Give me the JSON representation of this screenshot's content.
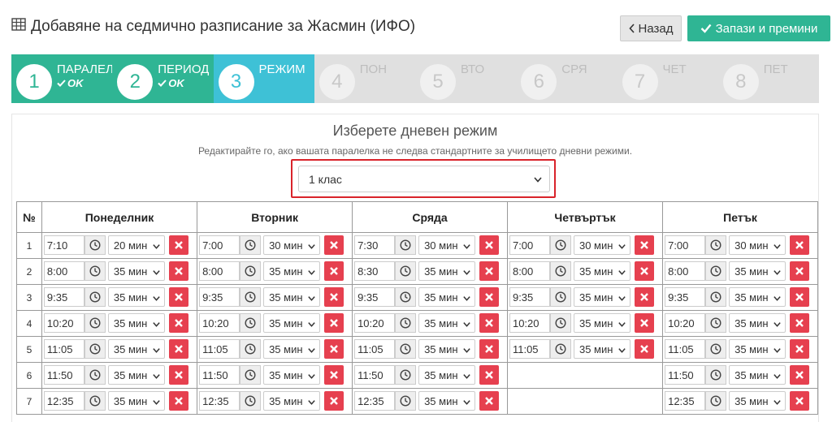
{
  "header": {
    "title": "Добавяне на седмично разписание за Жасмин (ИФО)",
    "back_label": "Назад",
    "save_label": "Запази и премини"
  },
  "steps": [
    {
      "num": "1",
      "label": "ПАРАЛЕЛ",
      "status": "OK",
      "state": "done"
    },
    {
      "num": "2",
      "label": "ПЕРИОД",
      "status": "OK",
      "state": "done"
    },
    {
      "num": "3",
      "label": "РЕЖИМ",
      "status": "",
      "state": "active"
    },
    {
      "num": "4",
      "label": "ПОН",
      "status": "",
      "state": "todo"
    },
    {
      "num": "5",
      "label": "ВТО",
      "status": "",
      "state": "todo"
    },
    {
      "num": "6",
      "label": "СРЯ",
      "status": "",
      "state": "todo"
    },
    {
      "num": "7",
      "label": "ЧЕТ",
      "status": "",
      "state": "todo"
    },
    {
      "num": "8",
      "label": "ПЕТ",
      "status": "",
      "state": "todo"
    }
  ],
  "regime": {
    "title": "Изберете дневен режим",
    "description": "Редактирайте го, ако вашата паралелка не следва стандартните за училището дневни режими.",
    "selected": "1 клас"
  },
  "table": {
    "num_header": "№",
    "days": [
      "Понеделник",
      "Вторник",
      "Сряда",
      "Четвъртък",
      "Петък"
    ],
    "rows": [
      {
        "num": "1",
        "cells": [
          {
            "time": "7:10",
            "duration": "20 мин"
          },
          {
            "time": "7:00",
            "duration": "30 мин"
          },
          {
            "time": "7:30",
            "duration": "30 мин"
          },
          {
            "time": "7:00",
            "duration": "30 мин"
          },
          {
            "time": "7:00",
            "duration": "30 мин"
          }
        ]
      },
      {
        "num": "2",
        "cells": [
          {
            "time": "8:00",
            "duration": "35 мин"
          },
          {
            "time": "8:00",
            "duration": "35 мин"
          },
          {
            "time": "8:30",
            "duration": "35 мин"
          },
          {
            "time": "8:00",
            "duration": "35 мин"
          },
          {
            "time": "8:00",
            "duration": "35 мин"
          }
        ]
      },
      {
        "num": "3",
        "cells": [
          {
            "time": "9:35",
            "duration": "35 мин"
          },
          {
            "time": "9:35",
            "duration": "35 мин"
          },
          {
            "time": "9:35",
            "duration": "35 мин"
          },
          {
            "time": "9:35",
            "duration": "35 мин"
          },
          {
            "time": "9:35",
            "duration": "35 мин"
          }
        ]
      },
      {
        "num": "4",
        "cells": [
          {
            "time": "10:20",
            "duration": "35 мин"
          },
          {
            "time": "10:20",
            "duration": "35 мин"
          },
          {
            "time": "10:20",
            "duration": "35 мин"
          },
          {
            "time": "10:20",
            "duration": "35 мин"
          },
          {
            "time": "10:20",
            "duration": "35 мин"
          }
        ]
      },
      {
        "num": "5",
        "cells": [
          {
            "time": "11:05",
            "duration": "35 мин"
          },
          {
            "time": "11:05",
            "duration": "35 мин"
          },
          {
            "time": "11:05",
            "duration": "35 мин"
          },
          {
            "time": "11:05",
            "duration": "35 мин"
          },
          {
            "time": "11:05",
            "duration": "35 мин"
          }
        ]
      },
      {
        "num": "6",
        "cells": [
          {
            "time": "11:50",
            "duration": "35 мин"
          },
          {
            "time": "11:50",
            "duration": "35 мин"
          },
          {
            "time": "11:50",
            "duration": "35 мин"
          },
          null,
          {
            "time": "11:50",
            "duration": "35 мин"
          }
        ]
      },
      {
        "num": "7",
        "cells": [
          {
            "time": "12:35",
            "duration": "35 мин"
          },
          {
            "time": "12:35",
            "duration": "35 мин"
          },
          {
            "time": "12:35",
            "duration": "35 мин"
          },
          null,
          {
            "time": "12:35",
            "duration": "35 мин"
          }
        ]
      }
    ]
  },
  "colors": {
    "success": "#2fb594",
    "active": "#3ec1d6",
    "danger": "#e6404f",
    "highlight": "#d9232a"
  },
  "icons": {
    "title": "table-icon",
    "back": "chevron-left-icon",
    "save": "check-icon",
    "time_picker": "clock-icon",
    "dropdown": "chevron-down-icon",
    "delete": "close-icon"
  }
}
